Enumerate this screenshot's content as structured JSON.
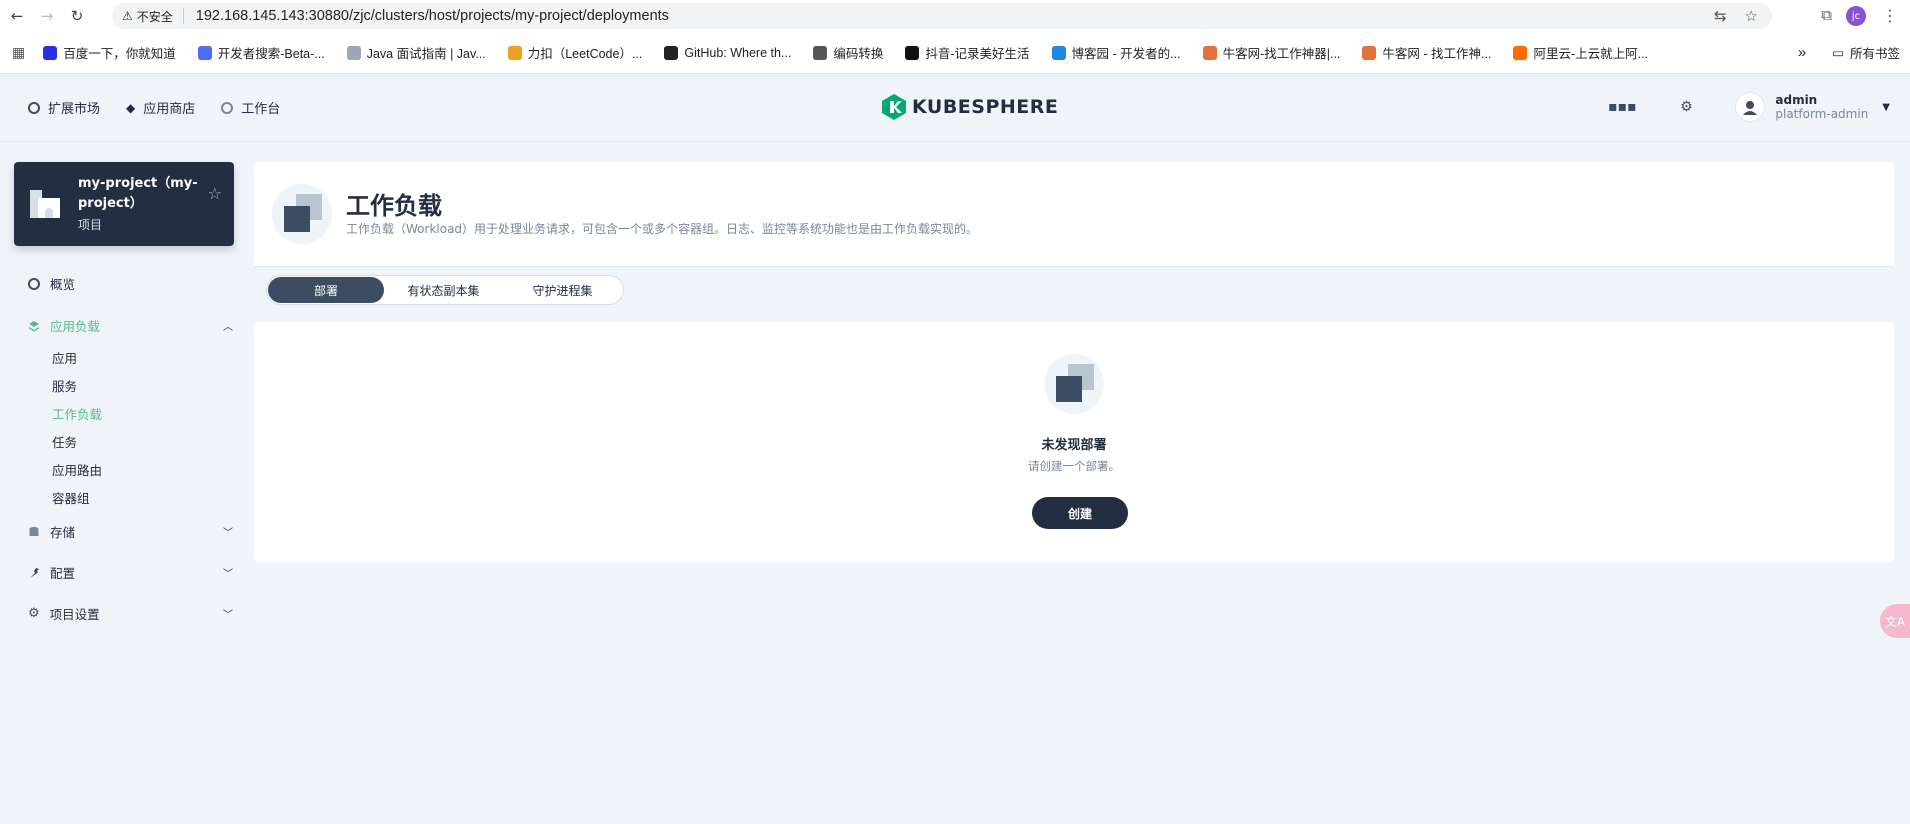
{
  "browser": {
    "insecure_label": "不安全",
    "url": "192.168.145.143:30880/zjc/clusters/host/projects/my-project/deployments",
    "profile_initials": "jc"
  },
  "bookmarks": {
    "items": [
      {
        "label": "百度一下，你就知道",
        "color": "#2932e1"
      },
      {
        "label": "开发者搜索-Beta-...",
        "color": "#4e6ef2"
      },
      {
        "label": "Java 面试指南 | Jav...",
        "color": "#9aa7b8"
      },
      {
        "label": "力扣（LeetCode）...",
        "color": "#f0a020"
      },
      {
        "label": "GitHub: Where th...",
        "color": "#222222"
      },
      {
        "label": "编码转换",
        "color": "#555555"
      },
      {
        "label": "抖音-记录美好生活",
        "color": "#111111"
      },
      {
        "label": "博客园 - 开发者的...",
        "color": "#1e88e5"
      },
      {
        "label": "牛客网-找工作神器|...",
        "color": "#e0733a"
      },
      {
        "label": "牛客网 - 找工作神...",
        "color": "#e0733a"
      },
      {
        "label": "阿里云-上云就上阿...",
        "color": "#ff6a00"
      }
    ],
    "more": "»",
    "all_bookmarks": "所有书签"
  },
  "header": {
    "nav": [
      {
        "label": "扩展市场",
        "icon": "extension-icon"
      },
      {
        "label": "应用商店",
        "icon": "app-store-icon"
      },
      {
        "label": "工作台",
        "icon": "workbench-icon"
      }
    ],
    "logo_text": "KUBESPHERE",
    "user_name": "admin",
    "user_role": "platform-admin"
  },
  "project": {
    "name": "my-project（my-project）",
    "subtitle": "项目"
  },
  "sidebar": {
    "overview": "概览",
    "app_workloads": "应用负载",
    "sub_items": [
      "应用",
      "服务",
      "工作负载",
      "任务",
      "应用路由",
      "容器组"
    ],
    "storage": "存储",
    "config": "配置",
    "project_settings": "项目设置"
  },
  "main": {
    "title": "工作负载",
    "description": "工作负载（Workload）用于处理业务请求，可包含一个或多个容器组。日志、监控等系统功能也是由工作负载实现的。",
    "tabs": [
      "部署",
      "有状态副本集",
      "守护进程集"
    ],
    "empty_title": "未发现部署",
    "empty_desc": "请创建一个部署。",
    "create_button": "创建"
  },
  "colors": {
    "accent_green": "#55bc8a",
    "dark": "#242e42",
    "bg": "#eff4f9"
  }
}
